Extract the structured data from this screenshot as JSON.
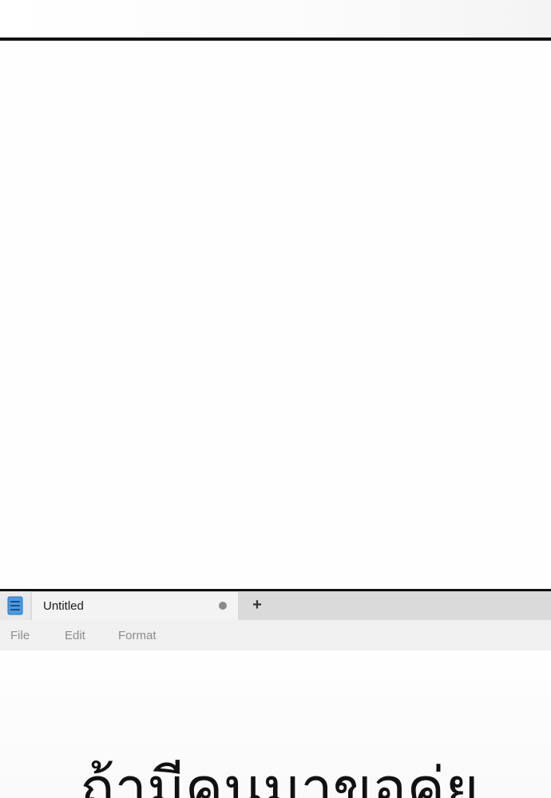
{
  "tab": {
    "title": "Untitled",
    "unsaved_indicator": "dot",
    "new_tab_label": "+"
  },
  "app": {
    "icon": "notepad-icon",
    "accent": "#3d8fd9"
  },
  "menu": {
    "items": [
      {
        "label": "File"
      },
      {
        "label": "Edit"
      },
      {
        "label": "Format"
      }
    ]
  },
  "editor": {
    "text": "ถ้ามีคนมาขอคู่ย"
  }
}
